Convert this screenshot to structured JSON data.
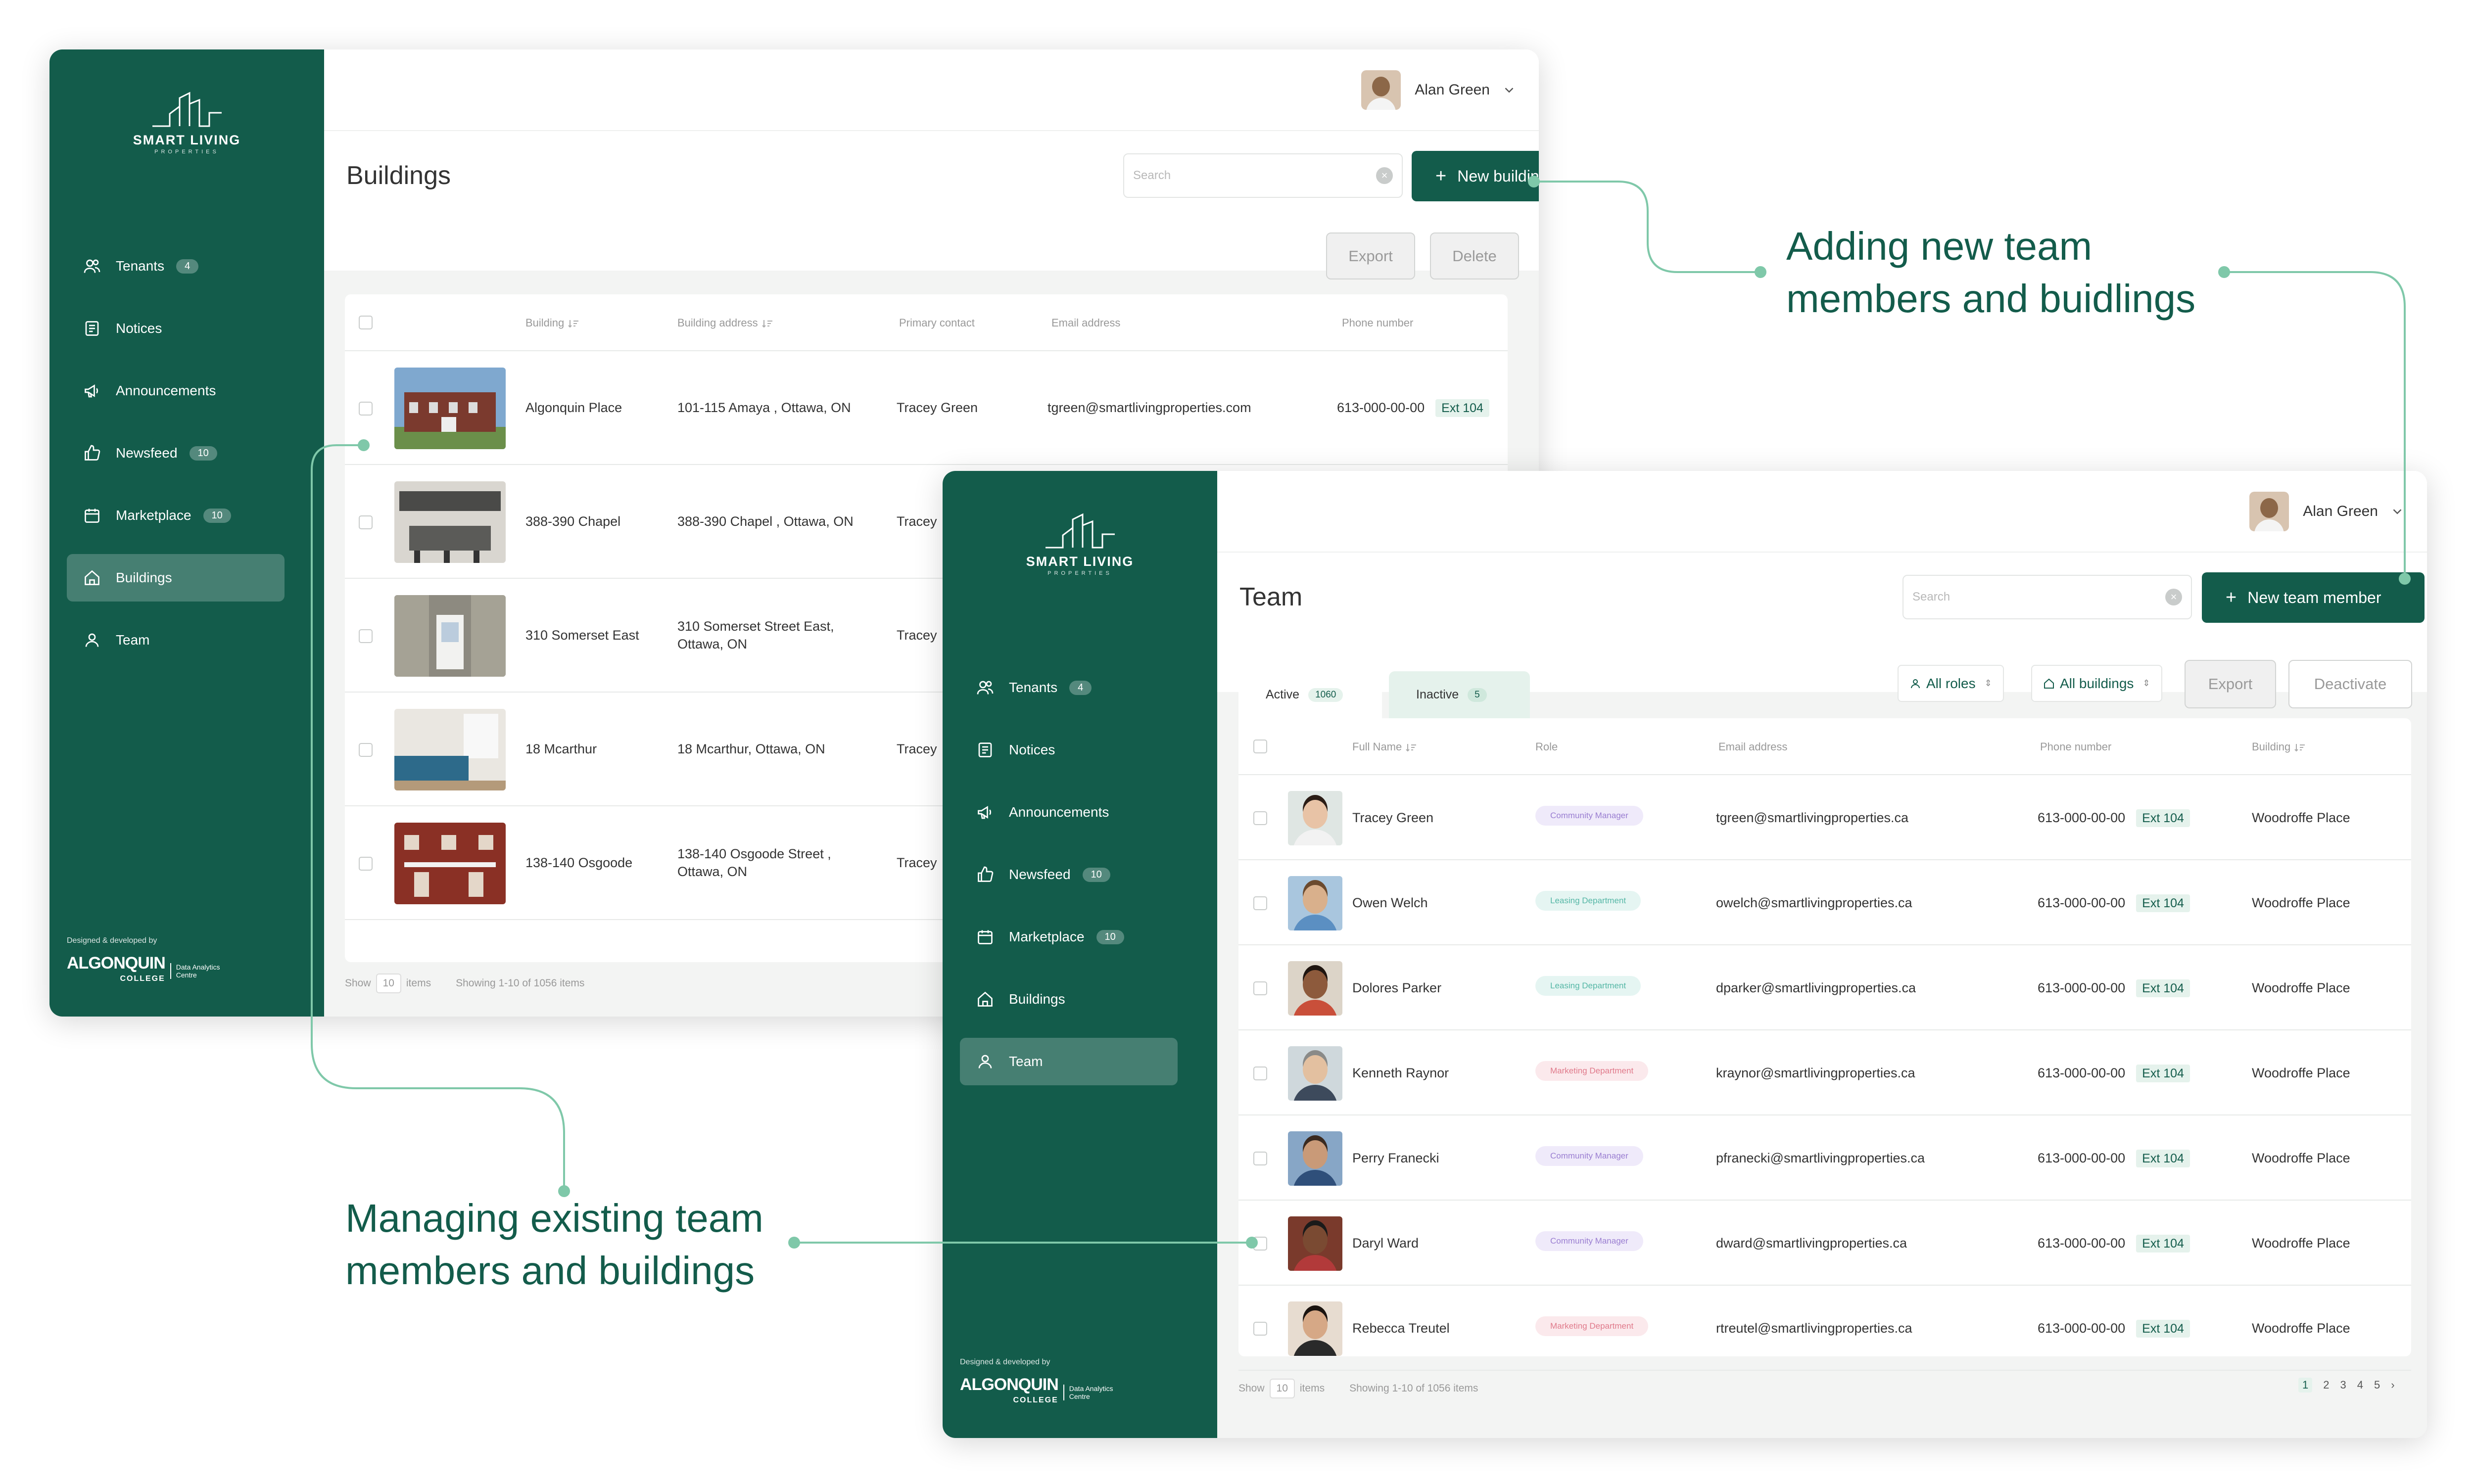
{
  "brand": {
    "logo_line1": "SMART LIVING",
    "logo_line2": "PROPERTIES"
  },
  "footer": {
    "designed_by": "Designed & developed by",
    "college_line1": "ALGONQUIN",
    "college_line2": "COLLEGE",
    "centre_line1": "Data Analytics",
    "centre_line2": "Centre"
  },
  "user": {
    "name": "Alan Green"
  },
  "nav": [
    {
      "label": "Tenants",
      "badge": "4"
    },
    {
      "label": "Notices",
      "badge": ""
    },
    {
      "label": "Announcements",
      "badge": ""
    },
    {
      "label": "Newsfeed",
      "badge": "10"
    },
    {
      "label": "Marketplace",
      "badge": "10"
    },
    {
      "label": "Buildings",
      "badge": ""
    },
    {
      "label": "Team",
      "badge": ""
    }
  ],
  "buildings": {
    "title": "Buildings",
    "search_placeholder": "Search",
    "new_button": "New building",
    "export": "Export",
    "delete": "Delete",
    "columns": [
      "Building",
      "Building address",
      "Primary contact",
      "Email address",
      "Phone number"
    ],
    "rows": [
      {
        "name": "Algonquin Place",
        "address": "101-115 Amaya , Ottawa, ON",
        "contact": "Tracey Green",
        "email": "tgreen@smartlivingproperties.com",
        "phone": "613-000-00-00",
        "ext": "Ext 104"
      },
      {
        "name": "388-390 Chapel",
        "address": "388-390 Chapel , Ottawa, ON",
        "contact": "Tracey",
        "email": "",
        "phone": "",
        "ext": ""
      },
      {
        "name": "310 Somerset East",
        "address": "310 Somerset Street East, Ottawa, ON",
        "contact": "Tracey",
        "email": "",
        "phone": "",
        "ext": ""
      },
      {
        "name": "18 Mcarthur",
        "address": "18 Mcarthur, Ottawa, ON",
        "contact": "Tracey",
        "email": "",
        "phone": "",
        "ext": ""
      },
      {
        "name": "138-140 Osgoode",
        "address": "138-140 Osgoode Street , Ottawa, ON",
        "contact": "Tracey",
        "email": "",
        "phone": "",
        "ext": ""
      }
    ],
    "footer": {
      "show": "Show",
      "per_page": "10",
      "items": "items",
      "showing": "Showing 1-10 of 1056 items"
    }
  },
  "team": {
    "title": "Team",
    "search_placeholder": "Search",
    "new_button": "New team member",
    "tabs": [
      {
        "label": "Active",
        "badge": "1060"
      },
      {
        "label": "Inactive",
        "badge": "5"
      }
    ],
    "filters": {
      "roles": "All roles",
      "buildings": "All buildings"
    },
    "export": "Export",
    "deactivate": "Deactivate",
    "columns": [
      "Full Name",
      "Role",
      "Email address",
      "Phone number",
      "Building"
    ],
    "rows": [
      {
        "name": "Tracey Green",
        "role": "Community Manager",
        "email": "tgreen@smartlivingproperties.ca",
        "phone": "613-000-00-00",
        "ext": "Ext 104",
        "building": "Woodroffe Place"
      },
      {
        "name": "Owen Welch",
        "role": "Leasing Department",
        "email": "owelch@smartlivingproperties.ca",
        "phone": "613-000-00-00",
        "ext": "Ext 104",
        "building": "Woodroffe Place"
      },
      {
        "name": "Dolores Parker",
        "role": "Leasing Department",
        "email": "dparker@smartlivingproperties.ca",
        "phone": "613-000-00-00",
        "ext": "Ext 104",
        "building": "Woodroffe Place"
      },
      {
        "name": "Kenneth Raynor",
        "role": "Marketing Department",
        "email": "kraynor@smartlivingproperties.ca",
        "phone": "613-000-00-00",
        "ext": "Ext 104",
        "building": "Woodroffe Place"
      },
      {
        "name": "Perry Franecki",
        "role": "Community Manager",
        "email": "pfranecki@smartlivingproperties.ca",
        "phone": "613-000-00-00",
        "ext": "Ext 104",
        "building": "Woodroffe Place"
      },
      {
        "name": "Daryl Ward",
        "role": "Community Manager",
        "email": "dward@smartlivingproperties.ca",
        "phone": "613-000-00-00",
        "ext": "Ext 104",
        "building": "Woodroffe Place"
      },
      {
        "name": "Rebecca Treutel",
        "role": "Marketing Department",
        "email": "rtreutel@smartlivingproperties.ca",
        "phone": "613-000-00-00",
        "ext": "Ext 104",
        "building": "Woodroffe Place"
      }
    ],
    "footer": {
      "show": "Show",
      "per_page": "10",
      "items": "items",
      "showing": "Showing 1-10 of 1056 items"
    },
    "pages": [
      "1",
      "2",
      "3",
      "4",
      "5"
    ]
  },
  "annotations": {
    "adding_line1": "Adding new team",
    "adding_line2": "members and buidlings",
    "managing_line1": "Managing existing team",
    "managing_line2": "members and buildings"
  },
  "colors": {
    "brand_green": "#135c4b",
    "accent_mint": "#7fc8a9"
  }
}
